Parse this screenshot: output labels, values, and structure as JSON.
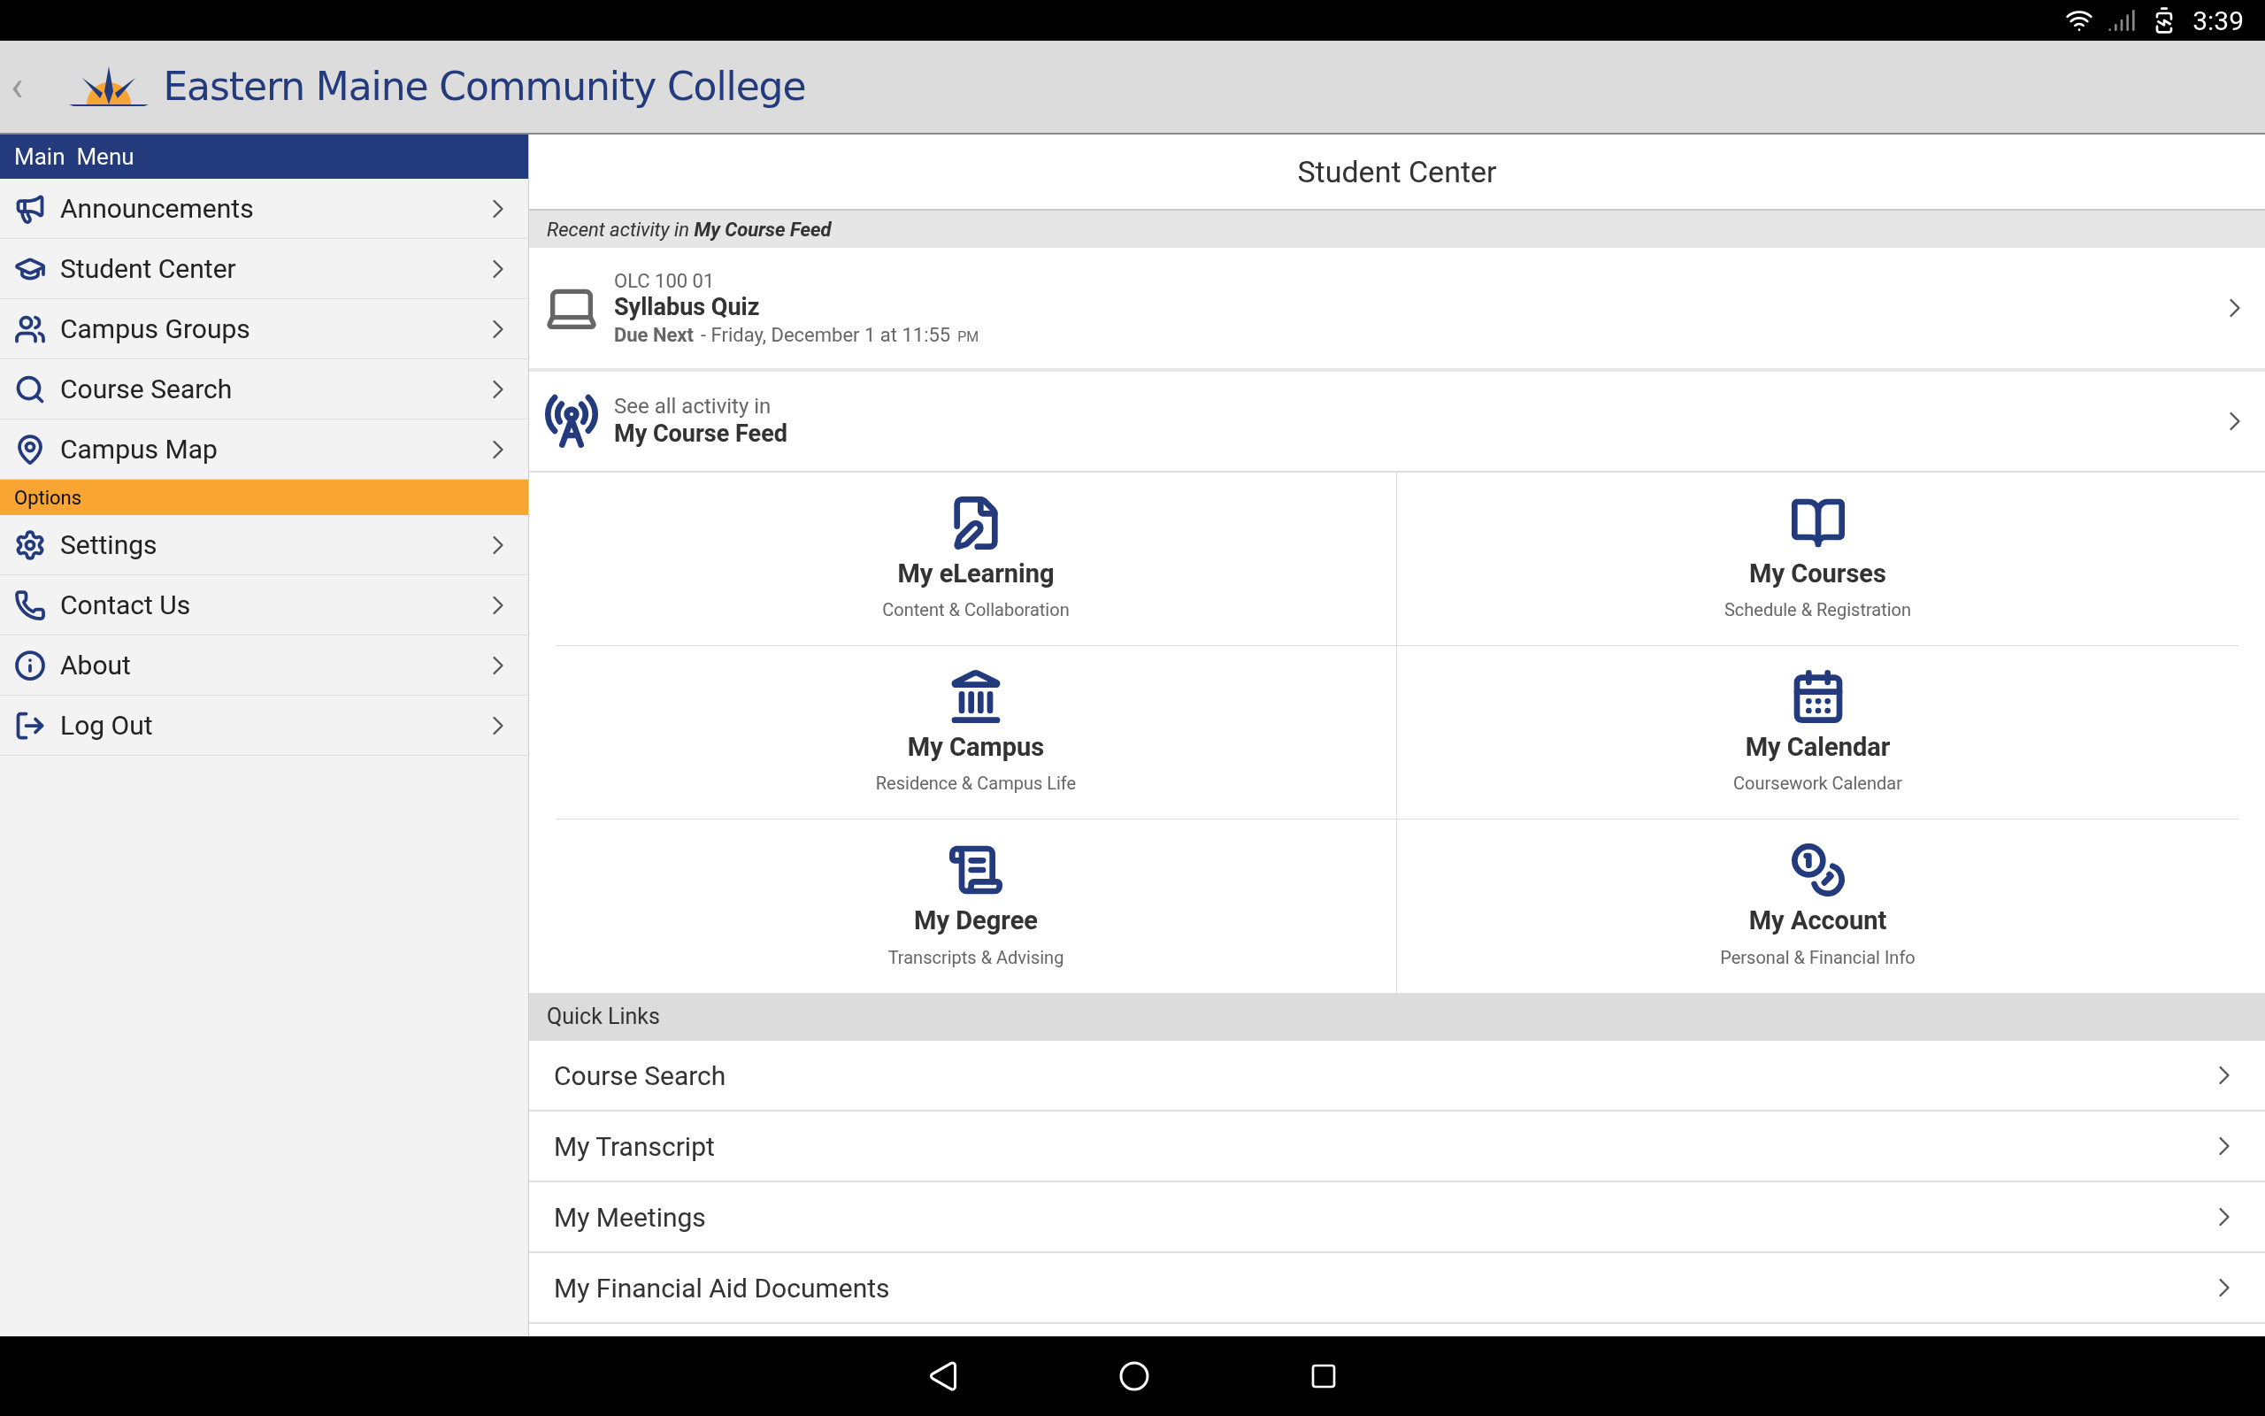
{
  "status_bar": {
    "time": "3:39"
  },
  "header": {
    "back": "‹",
    "title": "Eastern Maine Community College"
  },
  "sidebar": {
    "sections": [
      {
        "title": "Main  Menu",
        "kind": "main",
        "items": [
          {
            "label": "Announcements"
          },
          {
            "label": "Student Center"
          },
          {
            "label": "Campus Groups"
          },
          {
            "label": "Course Search"
          },
          {
            "label": "Campus Map"
          }
        ]
      },
      {
        "title": "Options",
        "kind": "options",
        "items": [
          {
            "label": "Settings"
          },
          {
            "label": "Contact Us"
          },
          {
            "label": "About"
          },
          {
            "label": "Log Out"
          }
        ]
      }
    ]
  },
  "content": {
    "title": "Student Center",
    "recent_header": "Recent activity in **My Course Feed**",
    "activity": {
      "course": "OLC 100 01",
      "title": "Syllabus Quiz",
      "due_label": "Due Next",
      "due_text": "- Friday, December 1 at 11:55",
      "due_suffix": "PM"
    },
    "feed": {
      "line1": "See all activity in",
      "line2": "My Course Feed"
    },
    "tiles": [
      {
        "title": "My eLearning",
        "subtitle": "Content & Collaboration"
      },
      {
        "title": "My Courses",
        "subtitle": "Schedule & Registration"
      },
      {
        "title": "My Campus",
        "subtitle": "Residence & Campus Life"
      },
      {
        "title": "My Calendar",
        "subtitle": "Coursework Calendar"
      },
      {
        "title": "My Degree",
        "subtitle": "Transcripts & Advising"
      },
      {
        "title": "My Account",
        "subtitle": "Personal & Financial Info"
      }
    ],
    "quick_links": {
      "title": "Quick Links",
      "items": [
        "Course Search",
        "My Transcript",
        "My Meetings",
        "My Financial Aid Documents"
      ]
    }
  }
}
